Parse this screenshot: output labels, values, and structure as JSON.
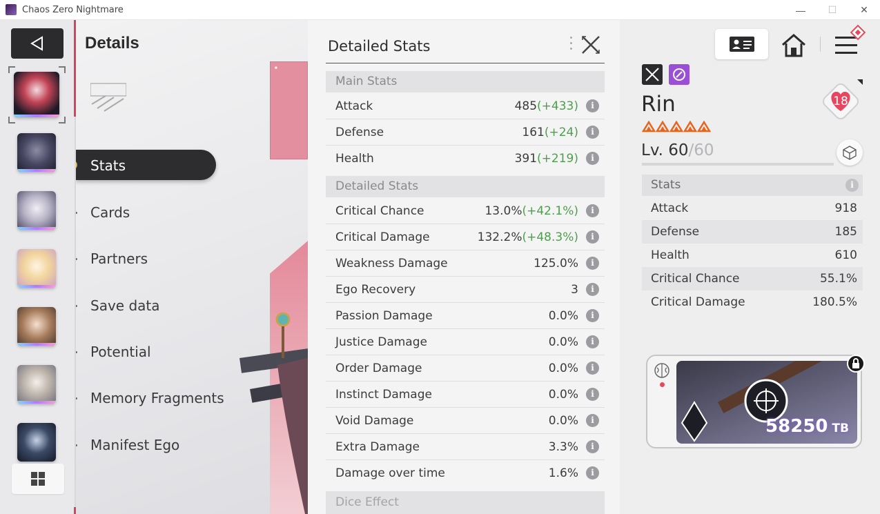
{
  "window": {
    "title": "Chaos Zero Nightmare",
    "minimize_glyph": "—",
    "maximize_glyph": "☐",
    "close_glyph": "✕"
  },
  "left": {
    "characters": [
      "selected",
      "wolf",
      "silver",
      "blonde",
      "brown",
      "ash",
      "dark"
    ]
  },
  "menu": {
    "heading": "Details",
    "active": "Stats",
    "items": [
      "Cards",
      "Partners",
      "Save data",
      "Potential",
      "Memory Fragments",
      "Manifest Ego"
    ]
  },
  "stats_panel": {
    "title": "Detailed Stats",
    "main_header": "Main Stats",
    "main": [
      {
        "name": "Attack",
        "base": "485",
        "bonus": "(+433)"
      },
      {
        "name": "Defense",
        "base": "161",
        "bonus": "(+24)"
      },
      {
        "name": "Health",
        "base": "391",
        "bonus": "(+219)"
      }
    ],
    "detail_header": "Detailed Stats",
    "detail": [
      {
        "name": "Critical Chance",
        "base": "13.0%",
        "bonus": "(+42.1%)"
      },
      {
        "name": "Critical Damage",
        "base": "132.2%",
        "bonus": "(+48.3%)"
      },
      {
        "name": "Weakness Damage",
        "base": "125.0%",
        "bonus": ""
      },
      {
        "name": "Ego Recovery",
        "base": "3",
        "bonus": ""
      },
      {
        "name": "Passion Damage",
        "base": "0.0%",
        "bonus": ""
      },
      {
        "name": "Justice Damage",
        "base": "0.0%",
        "bonus": ""
      },
      {
        "name": "Order Damage",
        "base": "0.0%",
        "bonus": ""
      },
      {
        "name": "Instinct Damage",
        "base": "0.0%",
        "bonus": ""
      },
      {
        "name": "Void Damage",
        "base": "0.0%",
        "bonus": ""
      },
      {
        "name": "Extra Damage",
        "base": "3.3%",
        "bonus": ""
      },
      {
        "name": "Damage over time",
        "base": "1.6%",
        "bonus": ""
      }
    ],
    "cut_header": "Dice Effect",
    "info_glyph": "i"
  },
  "character": {
    "name": "Rin",
    "level_prefix": "Lv. ",
    "level": "60",
    "level_sep": "/",
    "level_max": "60",
    "level_progress": 1.0,
    "affinity": "18",
    "rarity_stars": 5
  },
  "summary": {
    "header": "Stats",
    "rows": [
      {
        "name": "Attack",
        "value": "918"
      },
      {
        "name": "Defense",
        "value": "185"
      },
      {
        "name": "Health",
        "value": "610"
      },
      {
        "name": "Critical Chance",
        "value": "55.1%"
      },
      {
        "name": "Critical Damage",
        "value": "180.5%"
      }
    ]
  },
  "memory": {
    "value": "58250",
    "unit": " TB"
  },
  "colors": {
    "accent_red": "#d8405b",
    "bonus_green": "#4aa14a",
    "element_purple": "#9b4fd6",
    "star_orange": "#e8641c"
  }
}
